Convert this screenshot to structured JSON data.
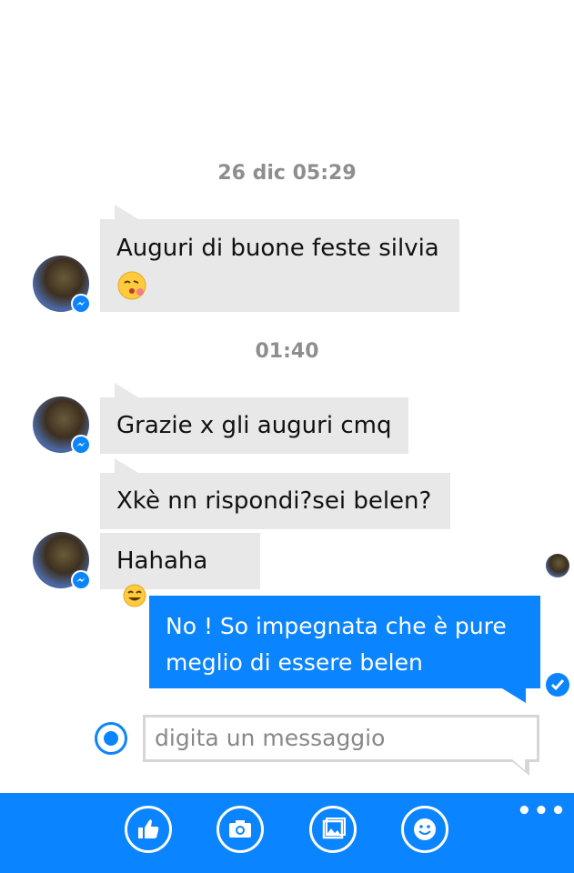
{
  "timestamps": [
    "26 dic 05:29",
    "01:40"
  ],
  "messages_incoming": [
    {
      "text_line1": "Auguri di buone feste silvia",
      "emoji": "kissing-face-emoji"
    },
    {
      "text": "Grazie x gli auguri cmq"
    },
    {
      "text": "Xkè nn rispondi?sei belen?"
    },
    {
      "text": "Hahaha",
      "emoji": "smiling-face-emoji"
    }
  ],
  "message_outgoing": {
    "line1": "No ! So impegnata che è pure",
    "line2": "meglio di essere belen",
    "status": "sent-check-icon"
  },
  "composer": {
    "placeholder": "digita un messaggio"
  },
  "toolbar": {
    "buttons": [
      "like-icon",
      "camera-icon",
      "gallery-icon",
      "emoji-icon"
    ],
    "more": "•••"
  },
  "colors": {
    "accent": "#0b84ff",
    "incoming_bubble": "#e8e8e8",
    "timestamp": "#8e8e8e"
  }
}
